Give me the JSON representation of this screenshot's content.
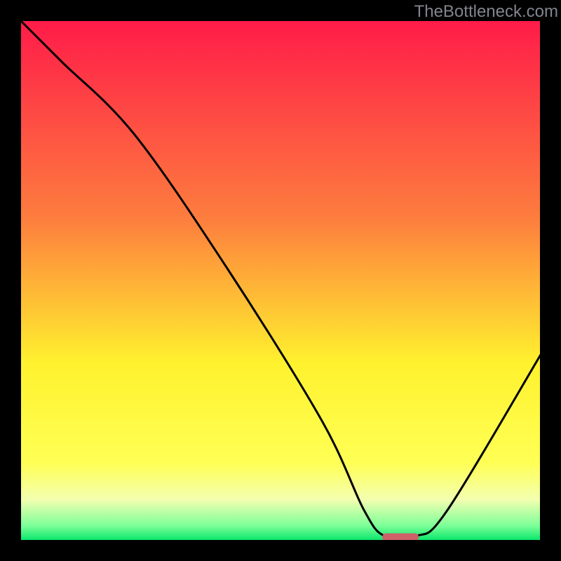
{
  "watermark": "TheBottleneck.com",
  "chart_data": {
    "type": "line",
    "title": "",
    "xlabel": "",
    "ylabel": "",
    "xlim": [
      0,
      100
    ],
    "ylim": [
      0,
      100
    ],
    "gradient_stops": [
      {
        "offset": 0,
        "color": "#ff1b49"
      },
      {
        "offset": 38,
        "color": "#fd7d3e"
      },
      {
        "offset": 66,
        "color": "#fff22e"
      },
      {
        "offset": 85,
        "color": "#ffff55"
      },
      {
        "offset": 92,
        "color": "#f3ffb0"
      },
      {
        "offset": 97,
        "color": "#7cff98"
      },
      {
        "offset": 100,
        "color": "#00e568"
      }
    ],
    "series": [
      {
        "name": "bottleneck-curve",
        "x": [
          0,
          8,
          22,
          40,
          58,
          66,
          70,
          76,
          82,
          100
        ],
        "y": [
          100,
          92,
          78,
          52,
          23,
          6,
          1,
          1,
          6,
          36
        ]
      }
    ],
    "marker": {
      "x_center": 73,
      "y": 0.8,
      "width": 7,
      "height": 1.5
    },
    "frame_inset": {
      "left": 4,
      "right": 4,
      "top": 4,
      "bottom": 4
    }
  }
}
